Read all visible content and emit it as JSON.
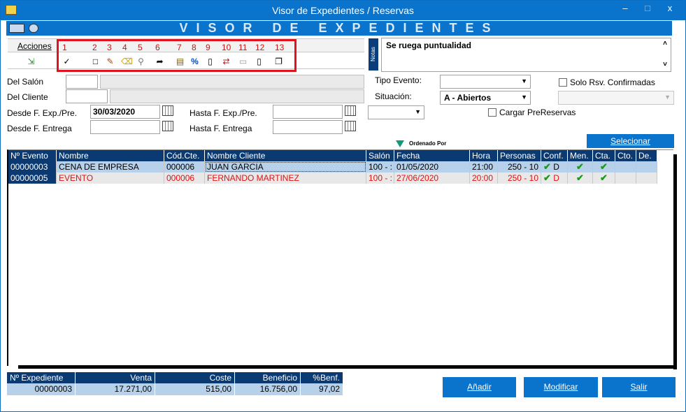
{
  "window": {
    "title": "Visor de Expedientes / Reservas",
    "minimize": "–",
    "maximize": "□",
    "close": "x"
  },
  "banner": {
    "title": "VISOR DE EXPEDIENTES"
  },
  "actions": {
    "label": "Acciones",
    "numbers": [
      "1",
      "2",
      "3",
      "4",
      "5",
      "6",
      "7",
      "8",
      "9",
      "10",
      "11",
      "12",
      "13"
    ]
  },
  "notes": {
    "label": "Notas",
    "text": "Se ruega puntualidad"
  },
  "filters": {
    "salon_label": "Del Salón",
    "cliente_label": "Del Cliente",
    "desde_exp_label": "Desde F. Exp./Pre.",
    "desde_exp_value": "30/03/2020",
    "hasta_exp_label": "Hasta F. Exp./Pre.",
    "desde_ent_label": "Desde F. Entrega",
    "hasta_ent_label": "Hasta F. Entrega",
    "tipo_evento_label": "Tipo Evento:",
    "situacion_label": "Situación:",
    "situacion_value": "A - Abiertos",
    "solo_rsv_label": "Solo Rsv. Confirmadas",
    "cargar_pre_label": "Cargar PreReservas"
  },
  "buttons": {
    "selecionar": "Selecionar",
    "anadir": "Añadir",
    "modificar": "Modificar",
    "salir": "Salir"
  },
  "ordered_by": "Ordenado Por",
  "table": {
    "headers": [
      "Nº Evento",
      "Nombre",
      "Cód.Cte.",
      "Nombre Cliente",
      "Salón",
      "Fecha",
      "Hora",
      "Personas",
      "Conf.",
      "Men.",
      "Cta.",
      "Cto.",
      "De."
    ],
    "rows": [
      {
        "evento": "00000003",
        "nombre": "CENA DE EMPRESA",
        "cod": "000006",
        "cliente": "JUAN GARCIA",
        "salon": "100 - :",
        "fecha": "01/05/2020",
        "hora": "21:00",
        "personas": "250 - 10",
        "conf_d": "D"
      },
      {
        "evento": "00000005",
        "nombre": "EVENTO",
        "cod": "000006",
        "cliente": "FERNANDO MARTINEZ",
        "salon": "100 - :",
        "fecha": "27/06/2020",
        "hora": "20:00",
        "personas": "250 - 10",
        "conf_d": "D"
      }
    ]
  },
  "summary": {
    "headers": [
      "Nº Expediente",
      "Venta",
      "Coste",
      "Beneficio",
      "%Benf."
    ],
    "values": [
      "00000003",
      "17.271,00",
      "515,00",
      "16.756,00",
      "97,02"
    ]
  },
  "colors": {
    "accent": "#0a73cc",
    "header": "#0b3a73",
    "highlight": "#e0141e"
  }
}
